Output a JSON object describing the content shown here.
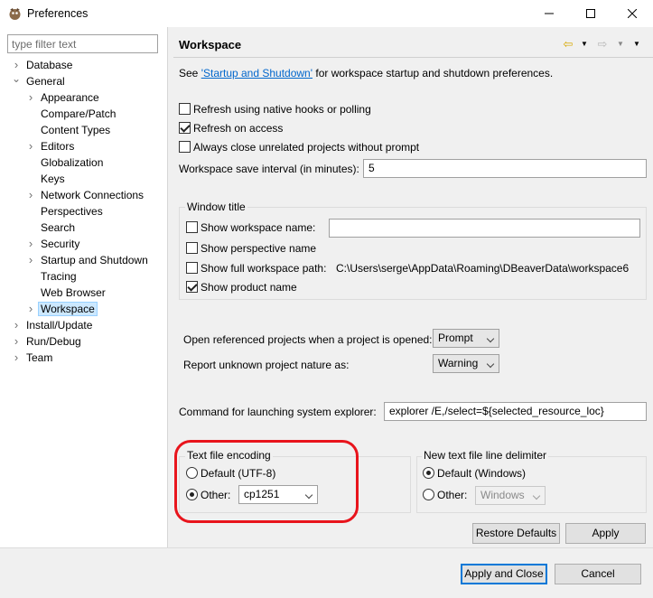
{
  "window": {
    "title": "Preferences"
  },
  "tree": {
    "filter_placeholder": "type filter text",
    "items": [
      {
        "label": "Database",
        "arrow": "right"
      },
      {
        "label": "General",
        "arrow": "down"
      },
      {
        "label": "Appearance",
        "arrow": "right"
      },
      {
        "label": "Compare/Patch",
        "arrow": ""
      },
      {
        "label": "Content Types",
        "arrow": ""
      },
      {
        "label": "Editors",
        "arrow": "right"
      },
      {
        "label": "Globalization",
        "arrow": ""
      },
      {
        "label": "Keys",
        "arrow": ""
      },
      {
        "label": "Network Connections",
        "arrow": "right"
      },
      {
        "label": "Perspectives",
        "arrow": ""
      },
      {
        "label": "Search",
        "arrow": ""
      },
      {
        "label": "Security",
        "arrow": "right"
      },
      {
        "label": "Startup and Shutdown",
        "arrow": "right"
      },
      {
        "label": "Tracing",
        "arrow": ""
      },
      {
        "label": "Web Browser",
        "arrow": ""
      },
      {
        "label": "Workspace",
        "arrow": "right",
        "selected": true
      },
      {
        "label": "Install/Update",
        "arrow": "right"
      },
      {
        "label": "Run/Debug",
        "arrow": "right"
      },
      {
        "label": "Team",
        "arrow": "right"
      }
    ]
  },
  "page": {
    "title": "Workspace",
    "see_prefix": "See ",
    "see_link": "'Startup and Shutdown'",
    "see_suffix": " for workspace startup and shutdown preferences.",
    "refresh_native": {
      "label": "Refresh using native hooks or polling",
      "checked": false
    },
    "refresh_access": {
      "label": "Refresh on access",
      "checked": true
    },
    "always_close": {
      "label": "Always close unrelated projects without prompt",
      "checked": false
    },
    "save_interval_label": "Workspace save interval (in minutes):",
    "save_interval_value": "5",
    "window_title": {
      "group_label": "Window title",
      "show_workspace_name": {
        "label": "Show workspace name:",
        "checked": false,
        "value": ""
      },
      "show_perspective_name": {
        "label": "Show perspective name",
        "checked": false
      },
      "show_full_path": {
        "label": "Show full workspace path:",
        "checked": false,
        "path": "C:\\Users\\serge\\AppData\\Roaming\\DBeaverData\\workspace6"
      },
      "show_product_name": {
        "label": "Show product name",
        "checked": true
      }
    },
    "open_referenced_label": "Open referenced projects when a project is opened:",
    "open_referenced_value": "Prompt",
    "report_unknown_label": "Report unknown project nature as:",
    "report_unknown_value": "Warning",
    "command_label": "Command for launching system explorer:",
    "command_value": "explorer /E,/select=${selected_resource_loc}",
    "encoding": {
      "group_label": "Text file encoding",
      "default_label": "Default (UTF-8)",
      "other_label": "Other:",
      "other_value": "cp1251",
      "selected": "other"
    },
    "delimiter": {
      "group_label": "New text file line delimiter",
      "default_label": "Default (Windows)",
      "other_label": "Other:",
      "other_value": "Windows",
      "selected": "default"
    },
    "restore_defaults": "Restore Defaults",
    "apply": "Apply"
  },
  "footer": {
    "apply_close": "Apply and Close",
    "cancel": "Cancel"
  },
  "colors": {
    "highlight": "#e8141c",
    "selection": "#cce8ff",
    "link": "#0066cc"
  }
}
